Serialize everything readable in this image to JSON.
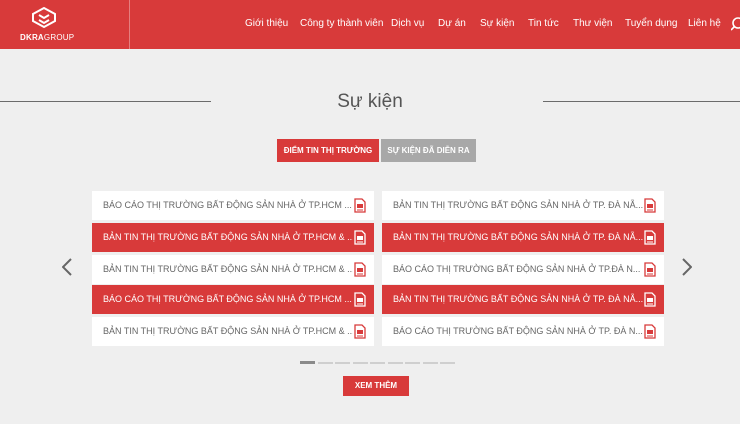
{
  "brand": {
    "logo_text_bold": "DKRA",
    "logo_text": "GROUP"
  },
  "nav": {
    "items": [
      "Giới thiệu",
      "Công ty thành viên",
      "Dịch vụ",
      "Dự án",
      "Sự kiện",
      "Tin tức",
      "Thư viện",
      "Tuyển dụng",
      "Liên hệ"
    ]
  },
  "section": {
    "title": "Sự kiện"
  },
  "tabs": [
    {
      "label": "ĐIỂM TIN THỊ TRƯỜNG",
      "active": true
    },
    {
      "label": "SỰ KIỆN ĐÃ DIỄN RA",
      "active": false
    }
  ],
  "items_left": [
    "BÁO CÁO THỊ TRƯỜNG BẤT ĐỘNG SẢN NHÀ Ở TP.HCM ...",
    "BẢN TIN THỊ TRƯỜNG BẤT ĐỘNG SẢN NHÀ Ở TP.HCM & ...",
    "BẢN TIN THỊ TRƯỜNG BẤT ĐỘNG SẢN NHÀ Ở TP.HCM & ...",
    "BÁO CÁO THỊ TRƯỜNG BẤT ĐỘNG SẢN NHÀ Ở TP.HCM ...",
    "BẢN TIN THỊ TRƯỜNG BẤT ĐỘNG SẢN NHÀ Ở TP.HCM & ..."
  ],
  "items_right": [
    "BẢN TIN THỊ TRƯỜNG BẤT ĐỘNG SẢN NHÀ Ở TP. ĐÀ NẴ...",
    "BẢN TIN THỊ TRƯỜNG BẤT ĐỘNG SẢN NHÀ Ở TP. ĐÀ NẴ...",
    "BÁO CÁO THỊ TRƯỜNG BẤT ĐỘNG SẢN NHÀ Ở TP.ĐÀ N...",
    "BẢN TIN THỊ TRƯỜNG BẤT ĐỘNG SẢN NHÀ Ở TP. ĐÀ NẴ...",
    "BÁO CÁO THỊ TRƯỜNG BẤT ĐỘNG SẢN NHÀ Ở TP. ĐÀ N..."
  ],
  "pagination": {
    "pages": 9,
    "current": 1
  },
  "more_button": {
    "label": "XEM THÊM"
  },
  "colors": {
    "brand_red": "#d83a3a",
    "background": "#efefef",
    "tab_inactive": "#a8a8a8"
  },
  "icons": {
    "document": "pdf-document-icon",
    "prev": "chevron-left-icon",
    "next": "chevron-right-icon",
    "search": "search-icon"
  }
}
